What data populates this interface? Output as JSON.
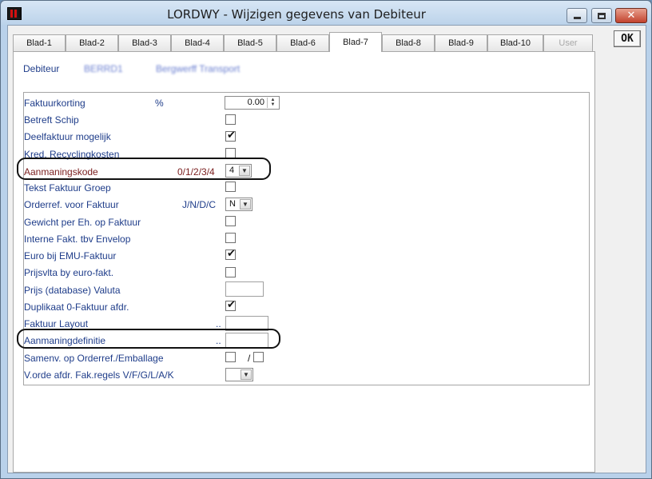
{
  "window": {
    "title": "LORDWY - Wijzigen gegevens van Debiteur",
    "ok_label": "OK"
  },
  "tabs": [
    {
      "label": "Blad-1",
      "state": "normal"
    },
    {
      "label": "Blad-2",
      "state": "normal"
    },
    {
      "label": "Blad-3",
      "state": "normal"
    },
    {
      "label": "Blad-4",
      "state": "normal"
    },
    {
      "label": "Blad-5",
      "state": "normal"
    },
    {
      "label": "Blad-6",
      "state": "normal"
    },
    {
      "label": "Blad-7",
      "state": "active"
    },
    {
      "label": "Blad-8",
      "state": "normal"
    },
    {
      "label": "Blad-9",
      "state": "normal"
    },
    {
      "label": "Blad-10",
      "state": "normal"
    },
    {
      "label": "User",
      "state": "disabled"
    }
  ],
  "debiteur": {
    "label": "Debiteur",
    "code": "BERRD1",
    "name": "Bergwerff Transport"
  },
  "fields": {
    "faktuurkorting": {
      "label": "Faktuurkorting",
      "unit": "%",
      "value": "0.00"
    },
    "betreft_schip": {
      "label": "Betreft Schip",
      "checked": false
    },
    "deelfaktuur": {
      "label": "Deelfaktuur mogelijk",
      "checked": true
    },
    "kred_recycling": {
      "label": "Kred. Recyclingkosten",
      "checked": false
    },
    "aanmaningskode": {
      "label": "Aanmaningskode",
      "hint": "0/1/2/3/4",
      "value": "4"
    },
    "tekst_faktuur_groep": {
      "label": "Tekst Faktuur Groep",
      "checked": false
    },
    "orderref": {
      "label": "Orderref. voor Faktuur",
      "hint": "J/N/D/C",
      "value": "N"
    },
    "gewicht": {
      "label": "Gewicht per Eh. op Faktuur",
      "checked": false
    },
    "interne_fakt": {
      "label": "Interne Fakt. tbv Envelop",
      "checked": false
    },
    "euro_emu": {
      "label": "Euro bij EMU-Faktuur",
      "checked": true
    },
    "prijsvlta": {
      "label": "Prijsvlta by euro-fakt.",
      "checked": false
    },
    "prijs_valuta": {
      "label": "Prijs (database) Valuta",
      "value": ""
    },
    "duplikaat": {
      "label": "Duplikaat 0-Faktuur afdr.",
      "checked": true
    },
    "faktuur_layout": {
      "label": "Faktuur Layout",
      "dots": "..",
      "value": ""
    },
    "aanmaningdefinitie": {
      "label": "Aanmaningdefinitie",
      "dots": "..",
      "value": ""
    },
    "samenv": {
      "label": "Samenv. op Orderref./Emballage",
      "sep": "/",
      "checked_a": false,
      "checked_b": false
    },
    "vorde": {
      "label": "V.orde afdr. Fak.regels V/F/G/L/A/K",
      "value": ""
    }
  },
  "checkmark_glyph": "✔",
  "colors": {
    "label": "#1f3d8a",
    "highlight_label": "#7a1e1e",
    "titlebar": "#c5daf0",
    "close_button": "#c2432e"
  }
}
